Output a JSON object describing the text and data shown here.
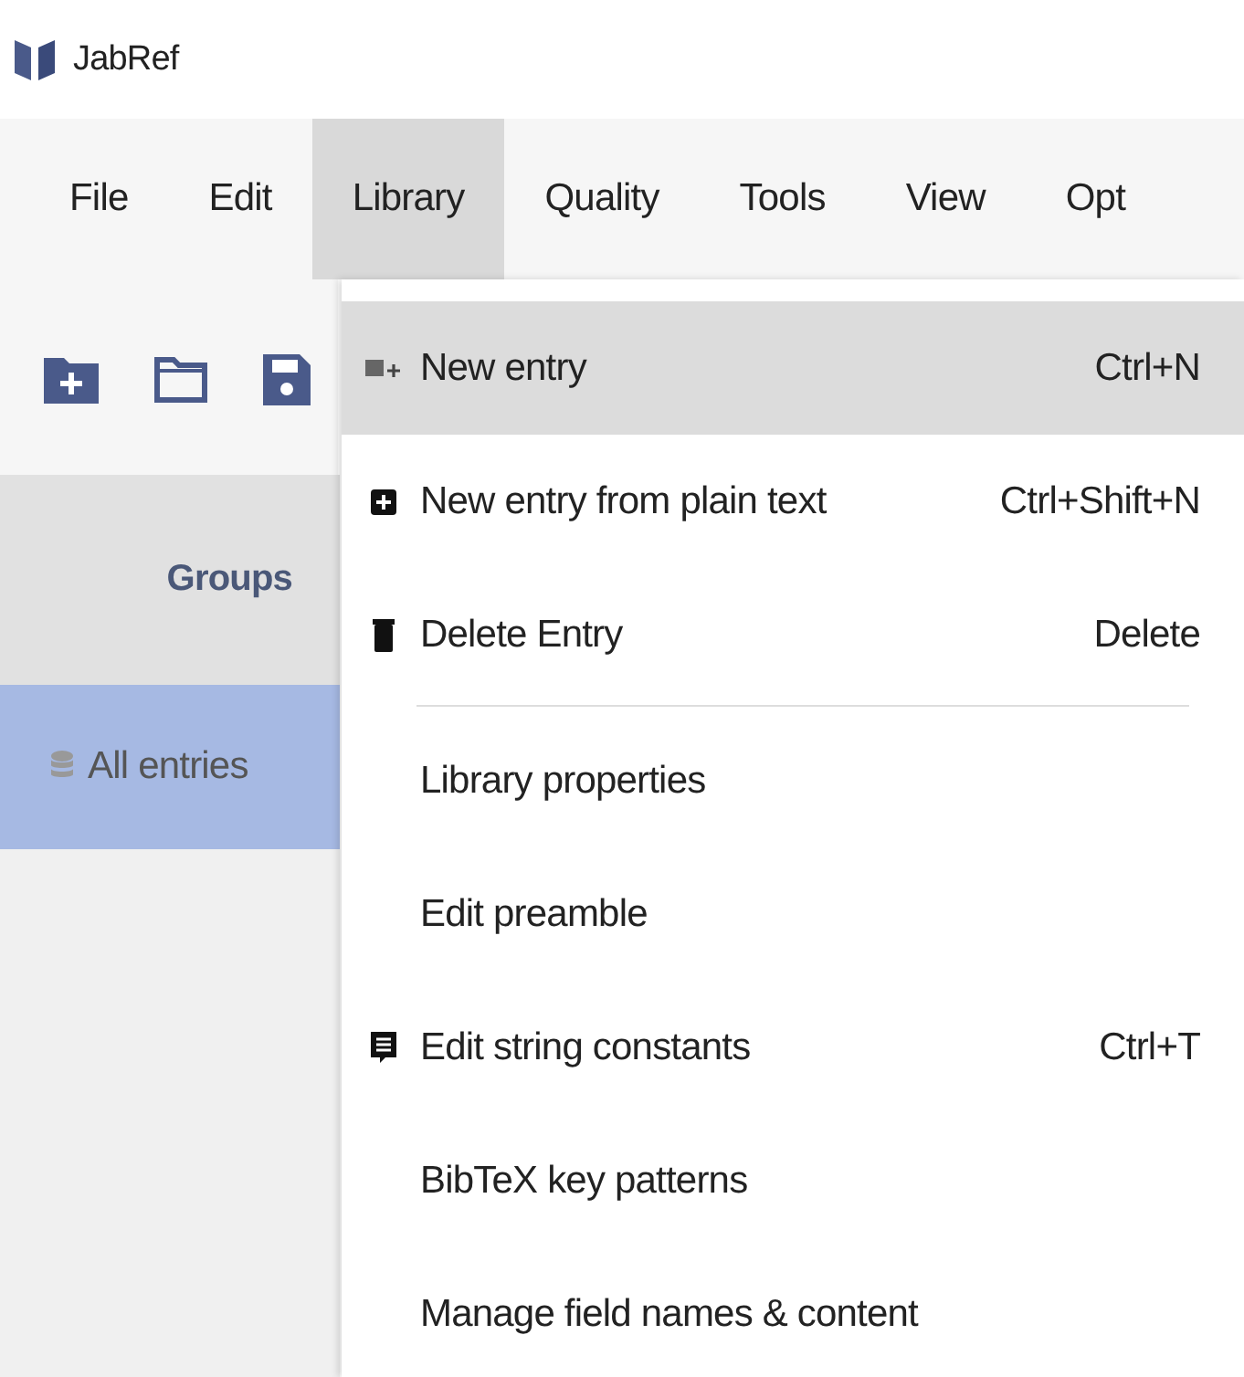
{
  "window": {
    "title": "JabRef"
  },
  "menubar": [
    {
      "label": "File",
      "selected": false
    },
    {
      "label": "Edit",
      "selected": false
    },
    {
      "label": "Library",
      "selected": true
    },
    {
      "label": "Quality",
      "selected": false
    },
    {
      "label": "Tools",
      "selected": false
    },
    {
      "label": "View",
      "selected": false
    },
    {
      "label": "Opt",
      "selected": false
    }
  ],
  "sidebar": {
    "header": "Groups",
    "items": [
      {
        "label": "All entries",
        "selected": true
      }
    ]
  },
  "menu": [
    {
      "kind": "item",
      "label": "New entry",
      "shortcut": "Ctrl+N",
      "highlighted": true
    },
    {
      "kind": "item",
      "label": "New entry from plain text",
      "shortcut": "Ctrl+Shift+N",
      "highlighted": false
    },
    {
      "kind": "item",
      "label": "Delete Entry",
      "shortcut": "Delete",
      "highlighted": false
    },
    {
      "kind": "separator"
    },
    {
      "kind": "item",
      "label": "Library properties",
      "highlighted": false
    },
    {
      "kind": "item",
      "label": "Edit preamble",
      "highlighted": false
    },
    {
      "kind": "item",
      "label": "Edit string constants",
      "shortcut": "Ctrl+T",
      "highlighted": false
    },
    {
      "kind": "item",
      "label": "BibTeX key patterns",
      "highlighted": false
    },
    {
      "kind": "item",
      "label": "Manage field names & content",
      "highlighted": false
    }
  ]
}
